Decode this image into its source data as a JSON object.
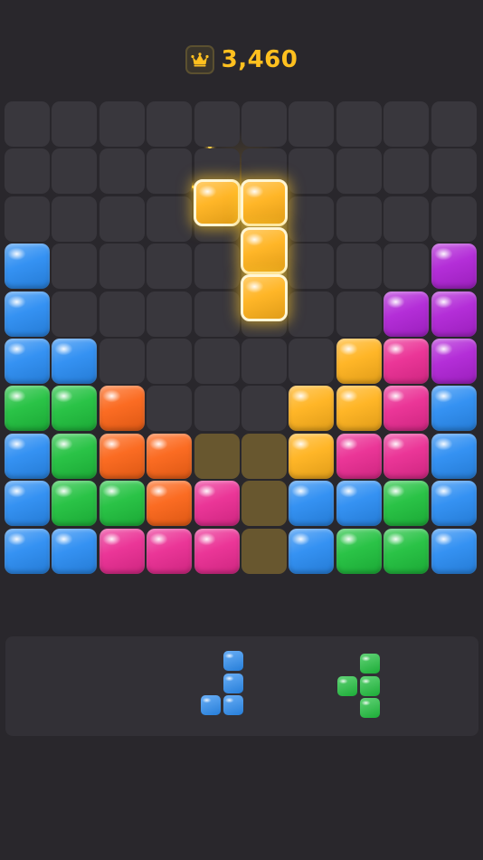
{
  "header": {
    "score_icon": "crown-icon",
    "score": "3,460"
  },
  "colors": {
    "empty": "#39373d",
    "ghost": "#6b5a2f",
    "blue": "#2a8cf2",
    "green": "#1fc03d",
    "orange": "#fb6417",
    "yellow": "#ffb21c",
    "pink": "#ea2b92",
    "purple": "#b023d6",
    "gold": "#ffc01f"
  },
  "board": {
    "rows": 10,
    "cols": 10,
    "cells": [
      [
        ".",
        ".",
        ".",
        ".",
        ".",
        ".",
        ".",
        ".",
        ".",
        "."
      ],
      [
        ".",
        ".",
        ".",
        ".",
        ".",
        ".",
        ".",
        ".",
        ".",
        "."
      ],
      [
        ".",
        ".",
        ".",
        ".",
        ".",
        ".",
        ".",
        ".",
        ".",
        "."
      ],
      [
        "B",
        ".",
        ".",
        ".",
        ".",
        ".",
        ".",
        ".",
        ".",
        "P"
      ],
      [
        "B",
        ".",
        ".",
        ".",
        ".",
        ".",
        ".",
        ".",
        "P",
        "P"
      ],
      [
        "B",
        "B",
        ".",
        ".",
        ".",
        ".",
        ".",
        "Y",
        "K",
        "P"
      ],
      [
        "G",
        "G",
        "O",
        ".",
        ".",
        ".",
        "Y",
        "Y",
        "K",
        "B"
      ],
      [
        "B",
        "G",
        "O",
        "O",
        "g",
        "g",
        "Y",
        "K",
        "K",
        "B"
      ],
      [
        "B",
        "G",
        "G",
        "O",
        "K",
        "g",
        "B",
        "B",
        "G",
        "B"
      ],
      [
        "B",
        "B",
        "K",
        "K",
        "K",
        "g",
        "B",
        "G",
        "G",
        "B"
      ]
    ],
    "legend": {
      ".": "empty",
      "g": "ghost",
      "B": "blue",
      "G": "green",
      "O": "orange",
      "Y": "yellow",
      "K": "pink",
      "P": "purple"
    }
  },
  "active_piece": {
    "color": "yellow",
    "cells": [
      [
        1,
        4
      ],
      [
        1,
        5
      ],
      [
        2,
        5
      ],
      [
        3,
        5
      ]
    ]
  },
  "tray": {
    "pieces": [
      {
        "color": "blue",
        "cells": [
          [
            0,
            1
          ],
          [
            1,
            1
          ],
          [
            2,
            0
          ],
          [
            2,
            1
          ]
        ]
      },
      {
        "color": "green",
        "cells": [
          [
            0,
            1
          ],
          [
            1,
            0
          ],
          [
            1,
            1
          ],
          [
            2,
            1
          ]
        ]
      }
    ]
  }
}
